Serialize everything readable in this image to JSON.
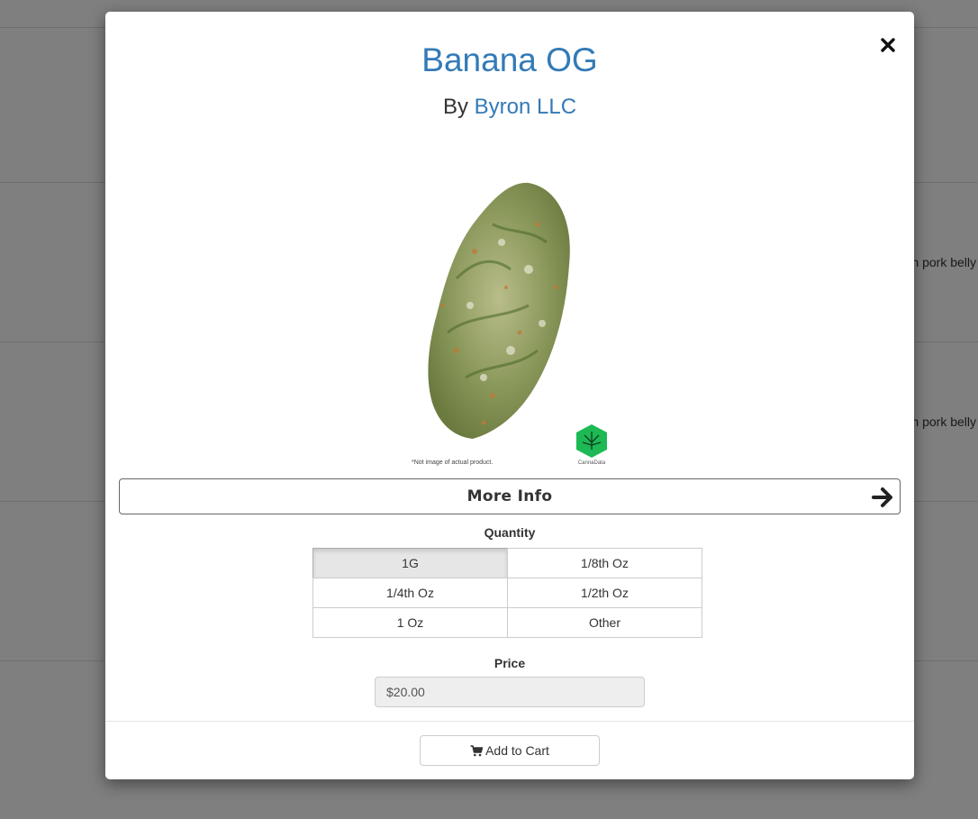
{
  "background": {
    "snippets": [
      "n pork belly",
      "n pork belly"
    ]
  },
  "modal": {
    "title": "Banana OG",
    "byline_prefix": "By",
    "brand": "Byron LLC",
    "image": {
      "disclaimer": "*Not image of actual product.",
      "brand_label": "CannaData"
    },
    "more_info_label": "More Info",
    "quantity": {
      "label": "Quantity",
      "options": [
        "1G",
        "1/8th Oz",
        "1/4th Oz",
        "1/2th Oz",
        "1 Oz",
        "Other"
      ],
      "selected": "1G"
    },
    "price": {
      "label": "Price",
      "value": "$20.00"
    },
    "add_to_cart_label": "Add to Cart"
  },
  "colors": {
    "link": "#337ab7",
    "overlay": "rgba(0,0,0,0.5)",
    "leaf_green": "#1db954"
  }
}
